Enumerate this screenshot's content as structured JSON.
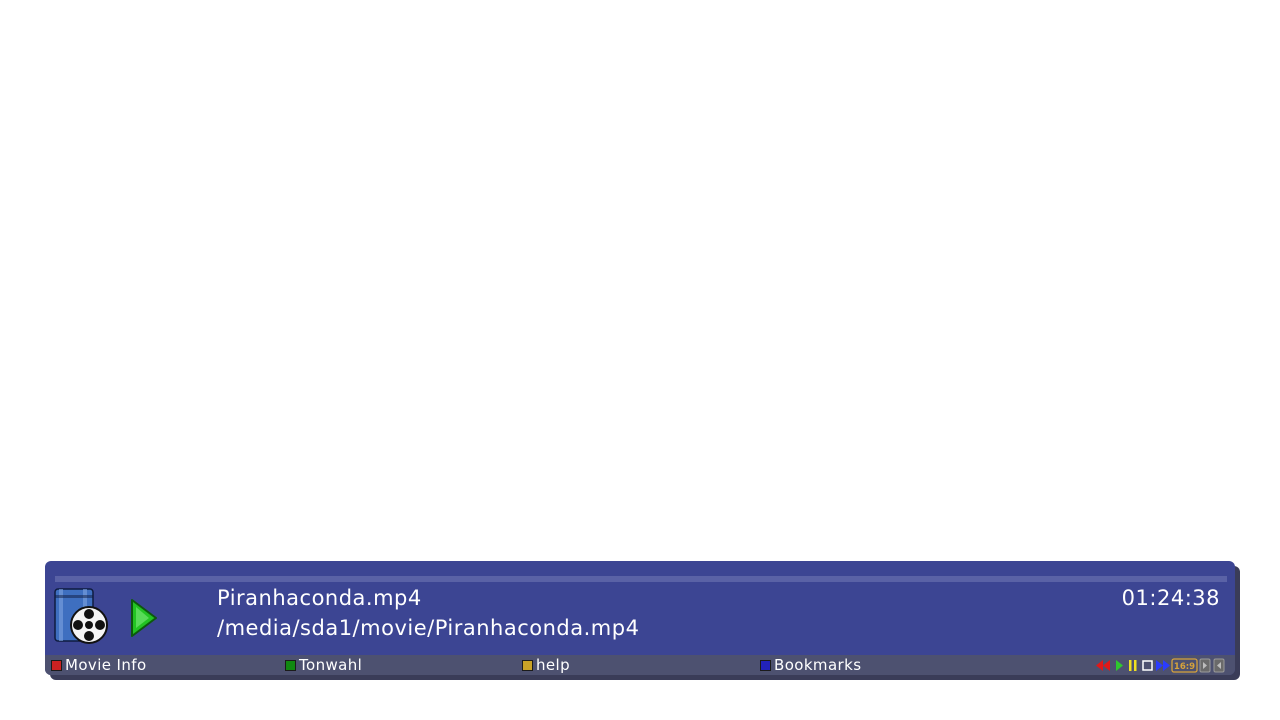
{
  "infobar": {
    "title": "Piranhaconda.mp4",
    "path": "/media/sda1/movie/Piranhaconda.mp4",
    "time": "01:24:38",
    "progress": 0.0,
    "play_state": "play-icon",
    "movie_icon": "movie-reel-icon"
  },
  "buttons": [
    {
      "label": "Movie Info",
      "color": "#cc2222"
    },
    {
      "label": "Tonwahl",
      "color": "#118811"
    },
    {
      "label": "help",
      "color": "#c9a227"
    },
    {
      "label": "Bookmarks",
      "color": "#2222bb"
    }
  ],
  "status_icons": [
    {
      "name": "rewind-icon",
      "color": "#e01818"
    },
    {
      "name": "play-icon",
      "color": "#2ec82e"
    },
    {
      "name": "pause-icon",
      "color": "#f0e020"
    },
    {
      "name": "stop-icon",
      "color": "#ffffff"
    },
    {
      "name": "fast-forward-icon",
      "color": "#2a3cff"
    },
    {
      "name": "aspect-ratio-icon",
      "label": "16:9",
      "color": "#d7a33b"
    },
    {
      "name": "subtitle-icon",
      "color": "#9a9a9a"
    },
    {
      "name": "teletext-icon",
      "color": "#9a9a9a"
    }
  ]
}
